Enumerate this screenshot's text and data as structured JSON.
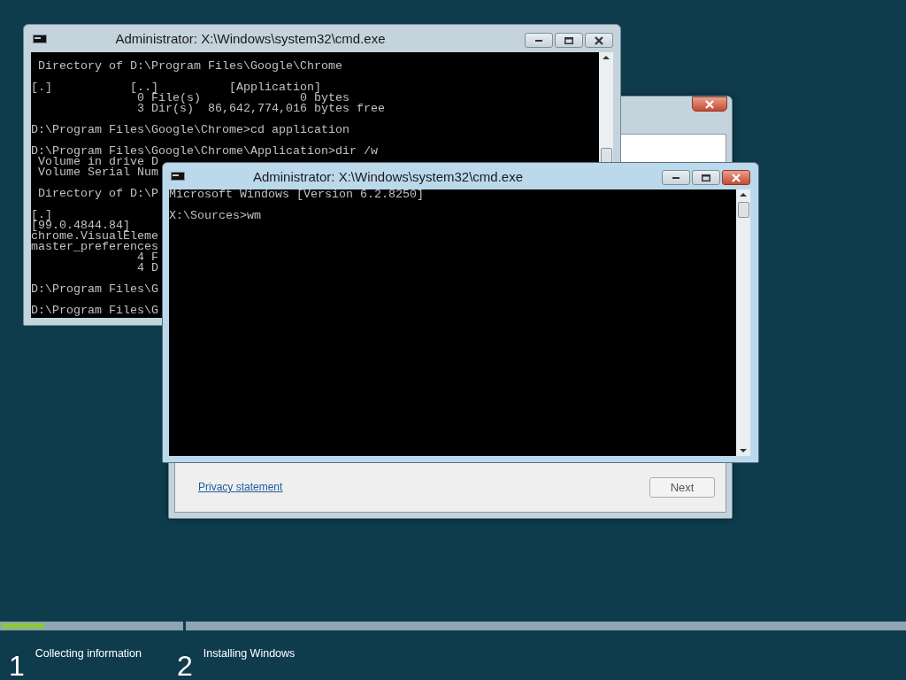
{
  "windows": [
    {
      "kind": "setup",
      "link": "Privacy statement",
      "button": "Next"
    },
    {
      "kind": "console",
      "title": "Administrator: X:\\Windows\\system32\\cmd.exe",
      "active": false,
      "blocks": [
        [
          " Directory of D:\\Program Files\\Google\\Chrome"
        ],
        [
          "[.]           [..]          [Application]",
          "               0 File(s)              0 bytes",
          "               3 Dir(s)  86,642,774,016 bytes free"
        ],
        [
          "D:\\Program Files\\Google\\Chrome>cd application"
        ],
        [
          "D:\\Program Files\\Google\\Chrome\\Application>dir /w",
          " Volume in drive D",
          " Volume Serial Num"
        ],
        [
          " Directory of D:\\P"
        ],
        [
          "[.]",
          "[99.0.4844.84]",
          "chrome.VisualEleme",
          "master_preferences",
          "               4 F",
          "               4 D"
        ],
        [
          "D:\\Program Files\\G"
        ],
        [
          "D:\\Program Files\\G"
        ]
      ]
    },
    {
      "kind": "console",
      "title": "Administrator: X:\\Windows\\system32\\cmd.exe",
      "active": true,
      "blocks": [
        [
          "Microsoft Windows [Version 6.2.8250]"
        ],
        [
          "X:\\Sources>wm"
        ]
      ]
    }
  ],
  "progress": {
    "steps": [
      {
        "number": "1",
        "label": "Collecting information",
        "level": 0.23
      },
      {
        "number": "2",
        "label": "Installing Windows",
        "level": 0
      }
    ]
  }
}
